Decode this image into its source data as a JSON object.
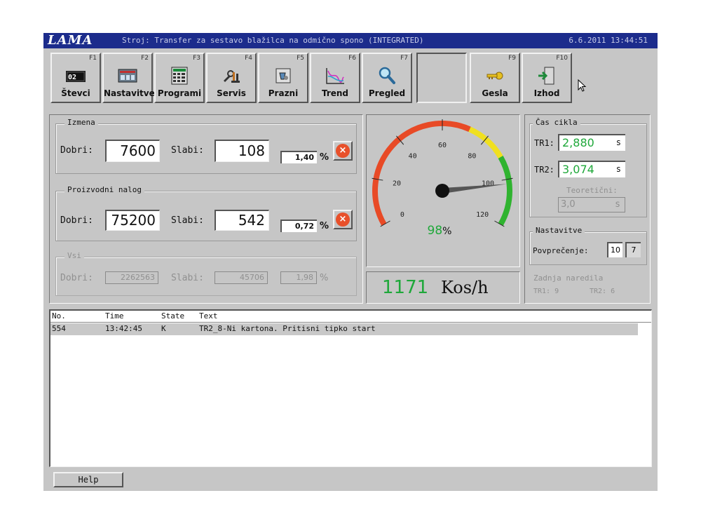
{
  "titlebar": {
    "logo": "LAMA",
    "title": "Stroj: Transfer za sestavo blažilca na odmično spono (INTEGRATED)",
    "datetime": "6.6.2011 13:44:51"
  },
  "toolbar": {
    "keys": [
      {
        "fn": "F1",
        "label": "Števci",
        "icon": "counter-icon",
        "counter_text": "02"
      },
      {
        "fn": "F2",
        "label": "Nastavitve",
        "icon": "settings-panel-icon"
      },
      {
        "fn": "F3",
        "label": "Programi",
        "icon": "program-grid-icon"
      },
      {
        "fn": "F4",
        "label": "Servis",
        "icon": "service-tools-icon"
      },
      {
        "fn": "F5",
        "label": "Prazni",
        "icon": "empty-bin-icon"
      },
      {
        "fn": "F6",
        "label": "Trend",
        "icon": "trend-chart-icon"
      },
      {
        "fn": "F7",
        "label": "Pregled",
        "icon": "magnifier-icon"
      },
      {
        "fn": "",
        "label": "",
        "icon": ""
      },
      {
        "fn": "F9",
        "label": "Gesla",
        "icon": "key-icon"
      },
      {
        "fn": "F10",
        "label": "Izhod",
        "icon": "exit-door-icon"
      }
    ]
  },
  "counters": {
    "izmena": {
      "title": "Izmena",
      "good_label": "Dobri:",
      "good_value": "7600",
      "bad_label": "Slabi:",
      "bad_value": "108",
      "percent": "1,40",
      "percent_sign": "%"
    },
    "nalog": {
      "title": "Proizvodni nalog",
      "good_label": "Dobri:",
      "good_value": "75200",
      "bad_label": "Slabi:",
      "bad_value": "542",
      "percent": "0,72",
      "percent_sign": "%"
    },
    "vsi": {
      "title": "Vsi",
      "good_label": "Dobri:",
      "good_value": "2262563",
      "bad_label": "Slabi:",
      "bad_value": "45706",
      "percent": "1,98",
      "percent_sign": "%"
    }
  },
  "gauge": {
    "ticks": [
      "0",
      "20",
      "40",
      "60",
      "80",
      "100",
      "120"
    ],
    "needle_value": 102,
    "min": 0,
    "max": 120,
    "efficiency": "98",
    "efficiency_sign": "%",
    "rate_value": "1171",
    "rate_unit": "Kos/h",
    "colors": {
      "red": "#e84a26",
      "yellow": "#f0e020",
      "green": "#2fb32f",
      "readout": "#1fa83a"
    }
  },
  "cycle": {
    "title": "Čas cikla",
    "tr1_label": "TR1:",
    "tr1_value": "2,880",
    "tr1_unit": "s",
    "tr2_label": "TR2:",
    "tr2_value": "3,074",
    "tr2_unit": "s",
    "theory_label": "Teoretični:",
    "theory_value": "3,0",
    "theory_unit": "s"
  },
  "settings": {
    "title": "Nastavitve",
    "avg_label": "Povprečenje:",
    "avg_value1": "10",
    "avg_value2": "7"
  },
  "last_cmd": {
    "title": "Zadnja naredila",
    "tr1": "TR1: 9",
    "tr2": "TR2: 6"
  },
  "messages": {
    "columns": [
      "No.",
      "Time",
      "State",
      "Text"
    ],
    "rows": [
      {
        "no": "554",
        "time": "13:42:45",
        "state": "K",
        "text": "TR2_8-Ni kartona. Pritisni tipko start"
      }
    ]
  },
  "help": {
    "label": "Help"
  }
}
